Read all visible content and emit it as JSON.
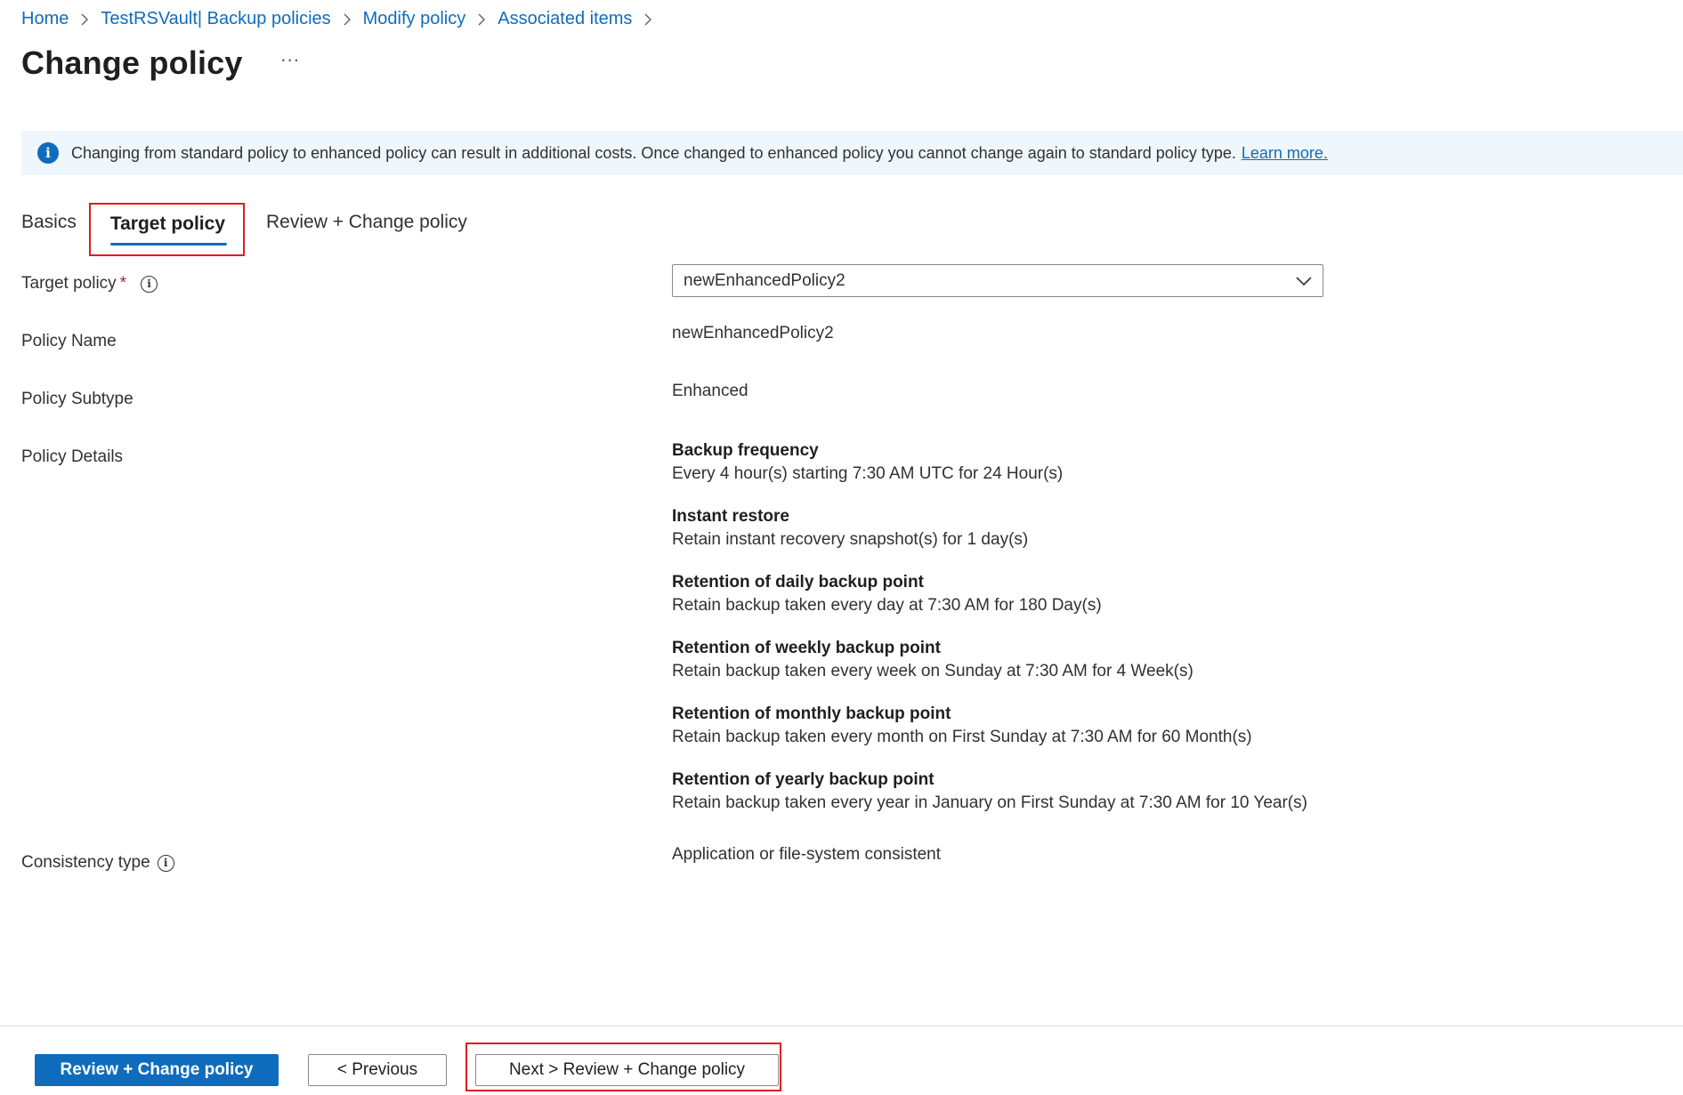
{
  "breadcrumb": {
    "items": [
      "Home",
      "TestRSVault| Backup policies",
      "Modify policy",
      "Associated items"
    ]
  },
  "header": {
    "title": "Change policy",
    "more_label": "···"
  },
  "banner": {
    "icon": "info-icon",
    "icon_glyph": "i",
    "text": "Changing from standard policy to enhanced policy can result in additional costs. Once changed to enhanced policy you cannot change again to standard policy type.",
    "link": "Learn more.",
    "background": "#eff6fc",
    "accent": "#0f6cbd"
  },
  "tabs": {
    "basics": "Basics",
    "target": "Target policy",
    "review": "Review + Change policy",
    "active": "Target policy"
  },
  "form": {
    "target_policy": {
      "label": "Target policy",
      "required_mark": "*",
      "selected": "newEnhancedPolicy2"
    },
    "policy_name": {
      "label": "Policy Name",
      "value": "newEnhancedPolicy2"
    },
    "policy_subtype": {
      "label": "Policy Subtype",
      "value": "Enhanced"
    },
    "policy_details": {
      "label": "Policy Details",
      "items": [
        {
          "title": "Backup frequency",
          "text": "Every 4 hour(s) starting 7:30 AM UTC for 24 Hour(s)"
        },
        {
          "title": "Instant restore",
          "text": "Retain instant recovery snapshot(s) for 1 day(s)"
        },
        {
          "title": "Retention of daily backup point",
          "text": "Retain backup taken every day at 7:30 AM for 180 Day(s)"
        },
        {
          "title": "Retention of weekly backup point",
          "text": "Retain backup taken every week on Sunday at 7:30 AM for 4 Week(s)"
        },
        {
          "title": "Retention of monthly backup point",
          "text": "Retain backup taken every month on First Sunday at 7:30 AM for 60 Month(s)"
        },
        {
          "title": "Retention of yearly backup point",
          "text": "Retain backup taken every year in January on First Sunday at 7:30 AM for 10 Year(s)"
        }
      ]
    },
    "consistency_type": {
      "label": "Consistency type",
      "value": "Application or file-system consistent"
    },
    "info_glyph": "i"
  },
  "footer": {
    "primary": "Review + Change policy",
    "previous": "< Previous",
    "next": "Next > Review + Change policy"
  },
  "colors": {
    "accent": "#0f6cbd",
    "highlight_border": "#e01b24",
    "required": "#a4262c"
  }
}
